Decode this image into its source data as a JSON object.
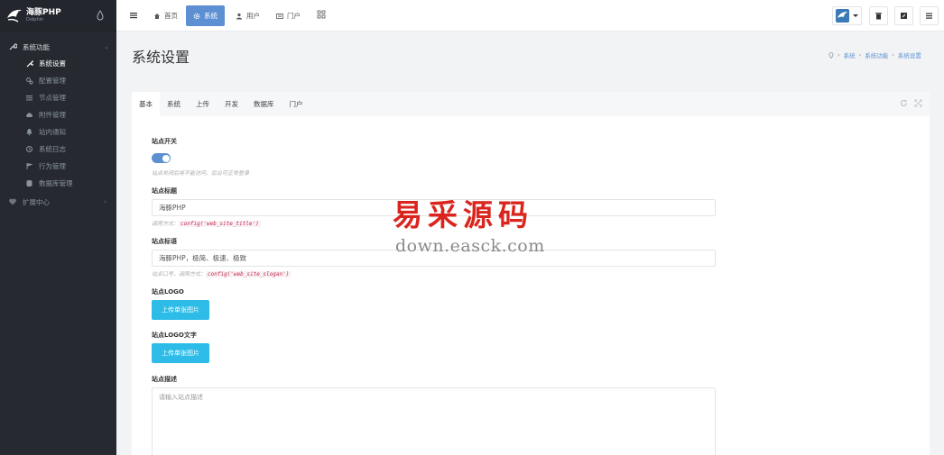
{
  "brand": {
    "title": "海豚PHP",
    "subtitle": "Dolphin"
  },
  "sidebar": {
    "group_title": "系统功能",
    "items": [
      {
        "label": "系统设置",
        "icon": "wrench-icon",
        "active": true
      },
      {
        "label": "配置管理",
        "icon": "gears-icon",
        "active": false
      },
      {
        "label": "节点管理",
        "icon": "list-icon",
        "active": false
      },
      {
        "label": "附件管理",
        "icon": "cloud-upload-icon",
        "active": false
      },
      {
        "label": "站内通知",
        "icon": "bell-icon",
        "active": false
      },
      {
        "label": "系统日志",
        "icon": "history-icon",
        "active": false
      },
      {
        "label": "行为管理",
        "icon": "flag-icon",
        "active": false
      },
      {
        "label": "数据库管理",
        "icon": "database-icon",
        "active": false
      }
    ],
    "ext_group_title": "扩展中心"
  },
  "header": {
    "tabs": [
      {
        "label": "首页",
        "icon": "home-icon"
      },
      {
        "label": "系统",
        "icon": "cog-icon"
      },
      {
        "label": "用户",
        "icon": "user-icon"
      },
      {
        "label": "门户",
        "icon": "newspaper-icon"
      }
    ]
  },
  "page": {
    "title": "系统设置",
    "breadcrumb": [
      "系统",
      "系统功能",
      "系统设置"
    ]
  },
  "panel": {
    "tabs": [
      "基本",
      "系统",
      "上传",
      "开发",
      "数据库",
      "门户"
    ]
  },
  "form": {
    "site_switch": {
      "label": "站点开关",
      "help": "站点关闭后将不能访问，后台可正常登录",
      "on": true
    },
    "site_title": {
      "label": "站点标题",
      "value": "海豚PHP",
      "help_prefix": "调用方式：",
      "help_code": "config('web_site_title')"
    },
    "site_slogan": {
      "label": "站点标语",
      "value": "海豚PHP，极简、极速、极致",
      "help_prefix": "站点口号，调用方式：",
      "help_code": "config('web_site_slogan')"
    },
    "site_logo": {
      "label": "站点LOGO",
      "button": "上传单张图片"
    },
    "site_logo_text": {
      "label": "站点LOGO文字",
      "button": "上传单张图片"
    },
    "site_desc": {
      "label": "站点描述",
      "placeholder": "请输入站点描述"
    }
  },
  "watermark": {
    "main": "易采源码",
    "sub": "down.easck.com"
  },
  "colors": {
    "sidebar_bg": "#262a30",
    "primary": "#5c90d2",
    "upload": "#2cbce7"
  }
}
